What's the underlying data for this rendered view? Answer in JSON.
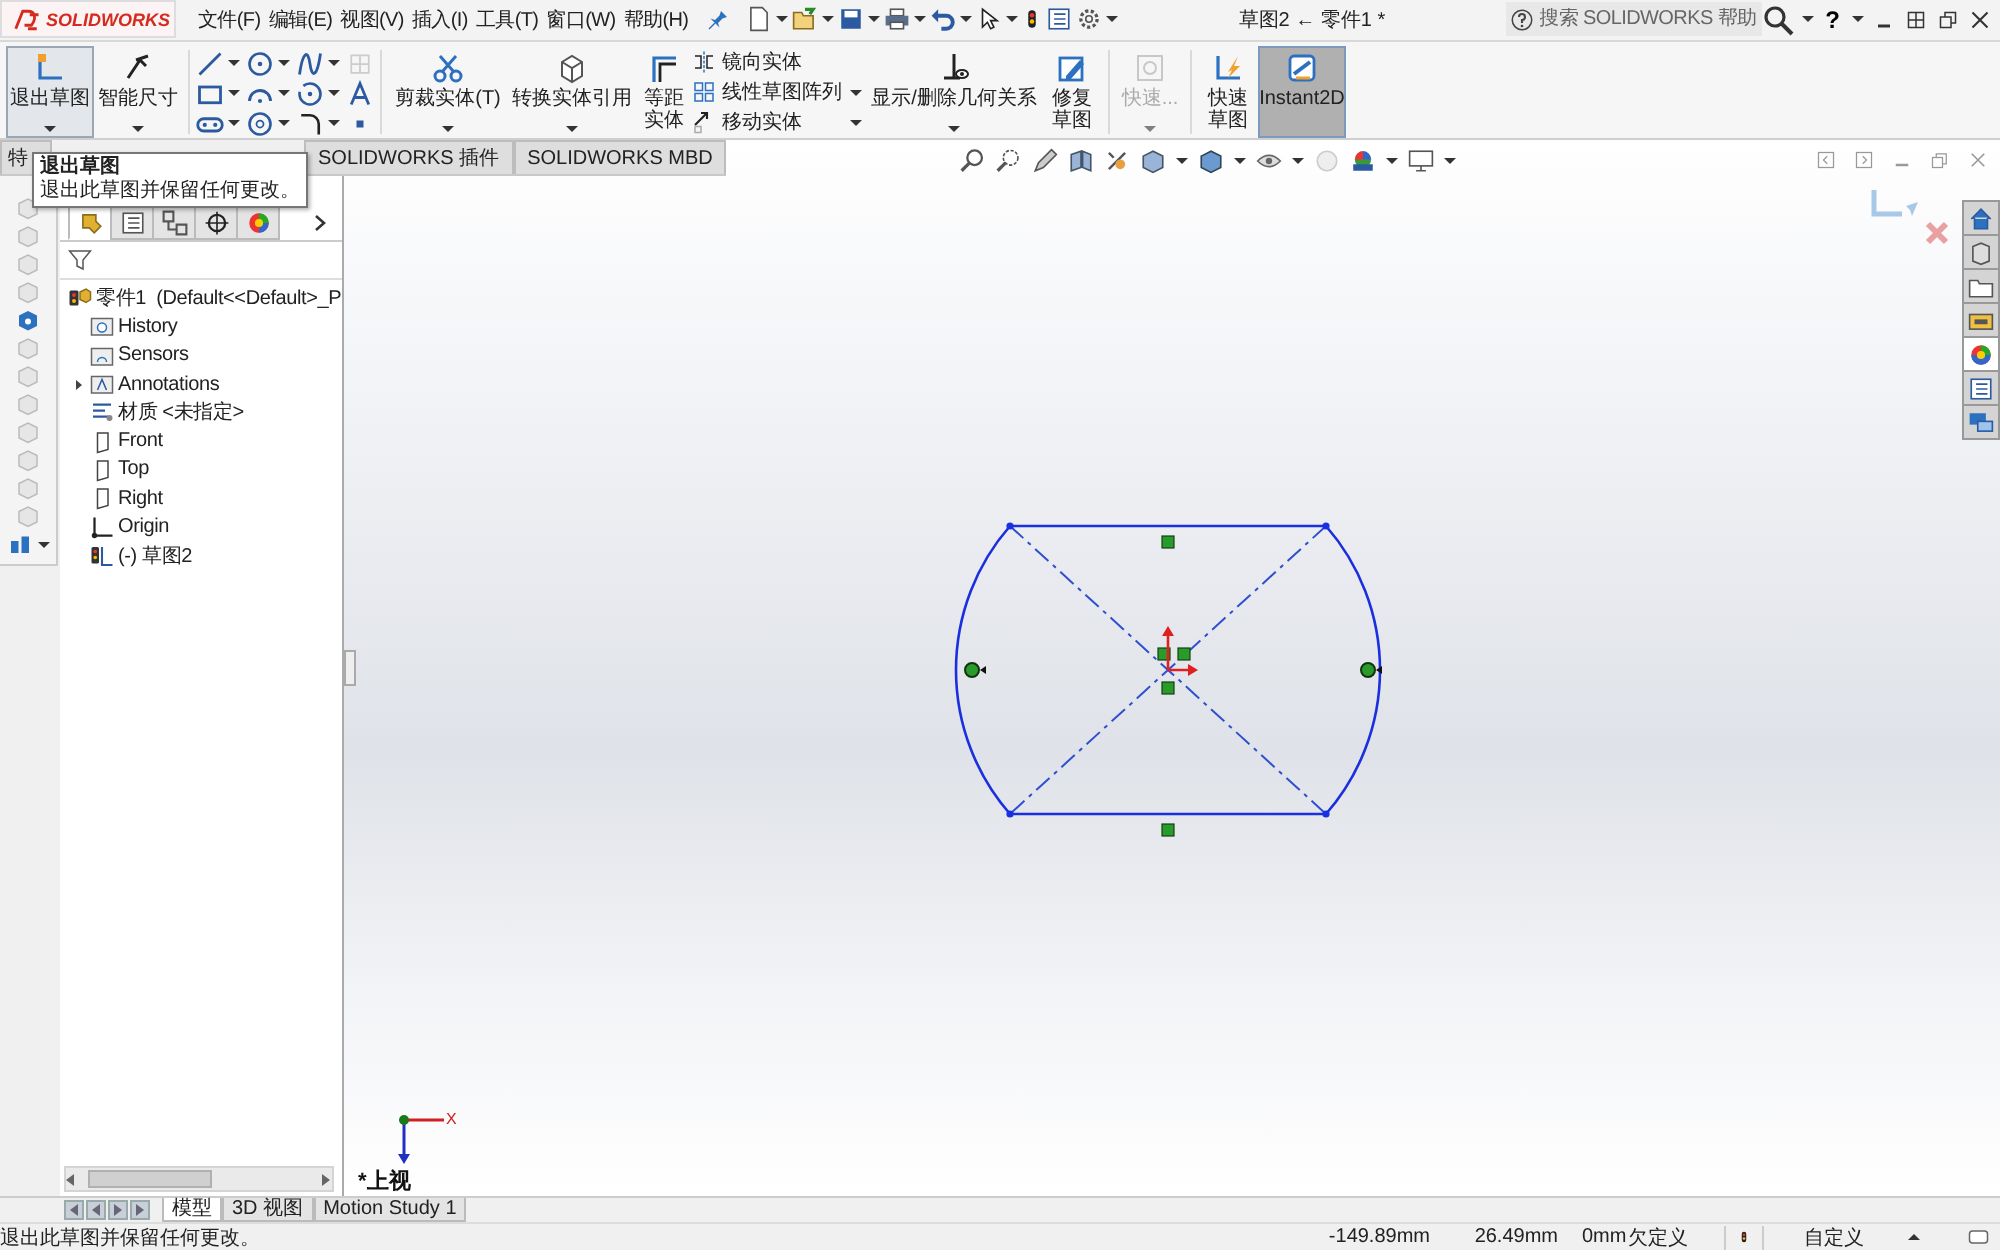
{
  "titlebar": {
    "logo": "SOLIDWORKS",
    "menus": [
      "文件(F)",
      "编辑(E)",
      "视图(V)",
      "插入(I)",
      "工具(T)",
      "窗口(W)",
      "帮助(H)"
    ],
    "title": "草图2 ← 零件1 *",
    "search": {
      "placeholder": "搜索 SOLIDWORKS 帮助"
    },
    "help_button": "?"
  },
  "ribbon": {
    "commands": [
      {
        "kind": "large",
        "label": "退出草图",
        "hovered": true,
        "selected": false,
        "disabled": false,
        "dropdown": true
      },
      {
        "kind": "large",
        "label": "智能尺寸",
        "hovered": false,
        "selected": false,
        "disabled": false,
        "dropdown": true
      },
      {
        "kind": "palette"
      },
      {
        "kind": "large",
        "label": "剪裁实体(T)",
        "hovered": false,
        "selected": false,
        "disabled": false,
        "dropdown": true
      },
      {
        "kind": "large",
        "label": "转换实体引用",
        "hovered": false,
        "selected": false,
        "disabled": false,
        "dropdown": true
      },
      {
        "kind": "large",
        "label": "等距实体",
        "hovered": false,
        "selected": false,
        "disabled": false,
        "dropdown": false
      },
      {
        "kind": "list",
        "items": [
          "镜向实体",
          "线性草图阵列",
          "移动实体"
        ]
      },
      {
        "kind": "large",
        "label": "显示/删除几何关系",
        "hovered": false,
        "selected": false,
        "disabled": false,
        "dropdown": true
      },
      {
        "kind": "large",
        "label": "修复草图",
        "hovered": false,
        "selected": false,
        "disabled": false,
        "dropdown": false
      },
      {
        "kind": "large",
        "label": "快速...",
        "hovered": false,
        "selected": false,
        "disabled": true,
        "dropdown": true
      },
      {
        "kind": "large",
        "label": "快速草图",
        "hovered": false,
        "selected": false,
        "disabled": false,
        "dropdown": false
      },
      {
        "kind": "large",
        "label": "Instant2D",
        "hovered": false,
        "selected": true,
        "disabled": false,
        "dropdown": false
      }
    ]
  },
  "command_tabs": [
    {
      "label": "特",
      "selected": false
    },
    {
      "label": "SOLIDWORKS 插件",
      "selected": false
    },
    {
      "label": "SOLIDWORKS MBD",
      "selected": false
    }
  ],
  "tooltip": {
    "title": "退出草图",
    "text": "退出此草图并保留任何更改。"
  },
  "feature_manager": {
    "tabs": [
      {
        "kind": "tree",
        "selected": true
      },
      {
        "kind": "property",
        "selected": false
      },
      {
        "kind": "config",
        "selected": false
      },
      {
        "kind": "dimxpert",
        "selected": false
      },
      {
        "kind": "display",
        "selected": false
      }
    ],
    "tree": {
      "label": "零件1  (Default<<Default>_P",
      "kind": "part",
      "children": [
        {
          "label": "History",
          "kind": "history"
        },
        {
          "label": "Sensors",
          "kind": "sensors"
        },
        {
          "label": "Annotations",
          "kind": "annotations",
          "expanded": false
        },
        {
          "label": "材质 <未指定>",
          "kind": "material"
        },
        {
          "label": "Front",
          "kind": "plane"
        },
        {
          "label": "Top",
          "kind": "plane"
        },
        {
          "label": "Right",
          "kind": "plane"
        },
        {
          "label": "Origin",
          "kind": "origin"
        },
        {
          "label": "(-) 草图2",
          "kind": "sketch"
        }
      ]
    }
  },
  "graphics": {
    "view_label": "*上视",
    "triad_label": "X"
  },
  "task_pane": [
    {
      "kind": "home",
      "selected": false
    },
    {
      "kind": "parts",
      "selected": false
    },
    {
      "kind": "folder",
      "selected": false
    },
    {
      "kind": "library",
      "selected": false
    },
    {
      "kind": "appearance",
      "selected": true
    },
    {
      "kind": "properties",
      "selected": false
    },
    {
      "kind": "forum",
      "selected": false
    }
  ],
  "bottom_tabs": [
    {
      "label": "模型",
      "selected": true
    },
    {
      "label": "3D 视图",
      "selected": false
    },
    {
      "label": "Motion Study 1",
      "selected": false
    }
  ],
  "status_bar": {
    "message": "退出此草图并保留任何更改。",
    "coordinates": [
      "-149.89mm",
      "26.49mm",
      "0mm"
    ],
    "state": "欠定义",
    "units": "自定义"
  }
}
